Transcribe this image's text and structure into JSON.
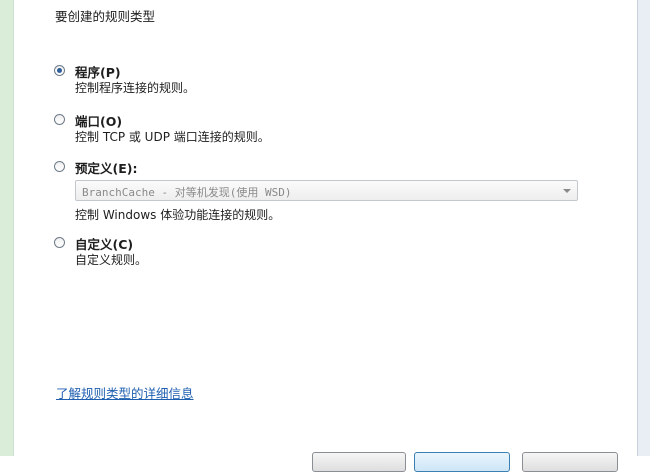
{
  "dialog": {
    "heading": "要创建的规则类型"
  },
  "options": [
    {
      "label": "程序(P)",
      "description": "控制程序连接的规则。",
      "selected": true
    },
    {
      "label": "端口(O)",
      "description": "控制 TCP 或 UDP 端口连接的规则。",
      "selected": false
    },
    {
      "label": "预定义(E):",
      "description": "控制 Windows 体验功能连接的规则。",
      "selected": false
    },
    {
      "label": "自定义(C)",
      "description": "自定义规则。",
      "selected": false
    }
  ],
  "predefined_select": {
    "value": "BranchCache - 对等机发现(使用 WSD)"
  },
  "help_link": "了解规则类型的详细信息",
  "colors": {
    "accent": "#2f5f9a",
    "link": "#1f5fb0",
    "left_strip": "#d9edd9"
  }
}
